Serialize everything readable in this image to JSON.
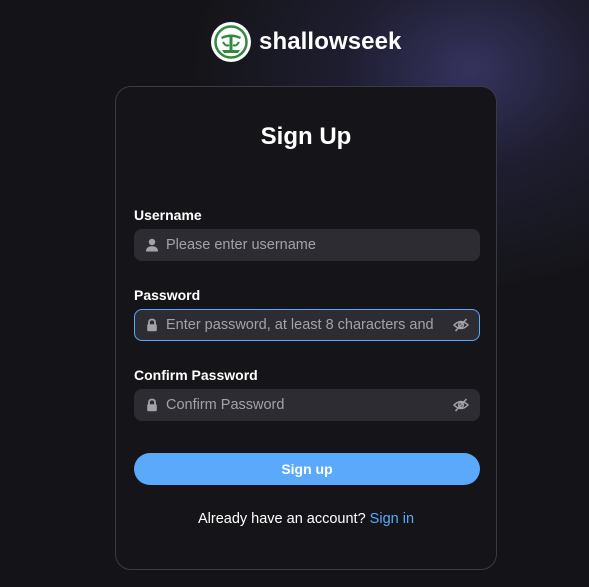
{
  "brand": {
    "name": "shallowseek",
    "logo_icon": "whale-emblem-icon"
  },
  "form": {
    "title": "Sign Up",
    "username": {
      "label": "Username",
      "placeholder": "Please enter username",
      "value": "",
      "icon": "user-icon"
    },
    "password": {
      "label": "Password",
      "placeholder": "Enter password, at least 8 characters and",
      "value": "",
      "icon": "lock-icon",
      "toggle_icon": "eye-off-icon",
      "focused": true
    },
    "confirm_password": {
      "label": "Confirm Password",
      "placeholder": "Confirm Password",
      "value": "",
      "icon": "lock-icon",
      "toggle_icon": "eye-off-icon"
    },
    "submit_label": "Sign up",
    "footer_prompt": "Already have an account?",
    "footer_link": "Sign in"
  },
  "colors": {
    "accent": "#5aa9fa",
    "background": "#141418",
    "card_background": "#151519",
    "input_background": "#2c2c32",
    "logo_green": "#2e8b3e"
  }
}
